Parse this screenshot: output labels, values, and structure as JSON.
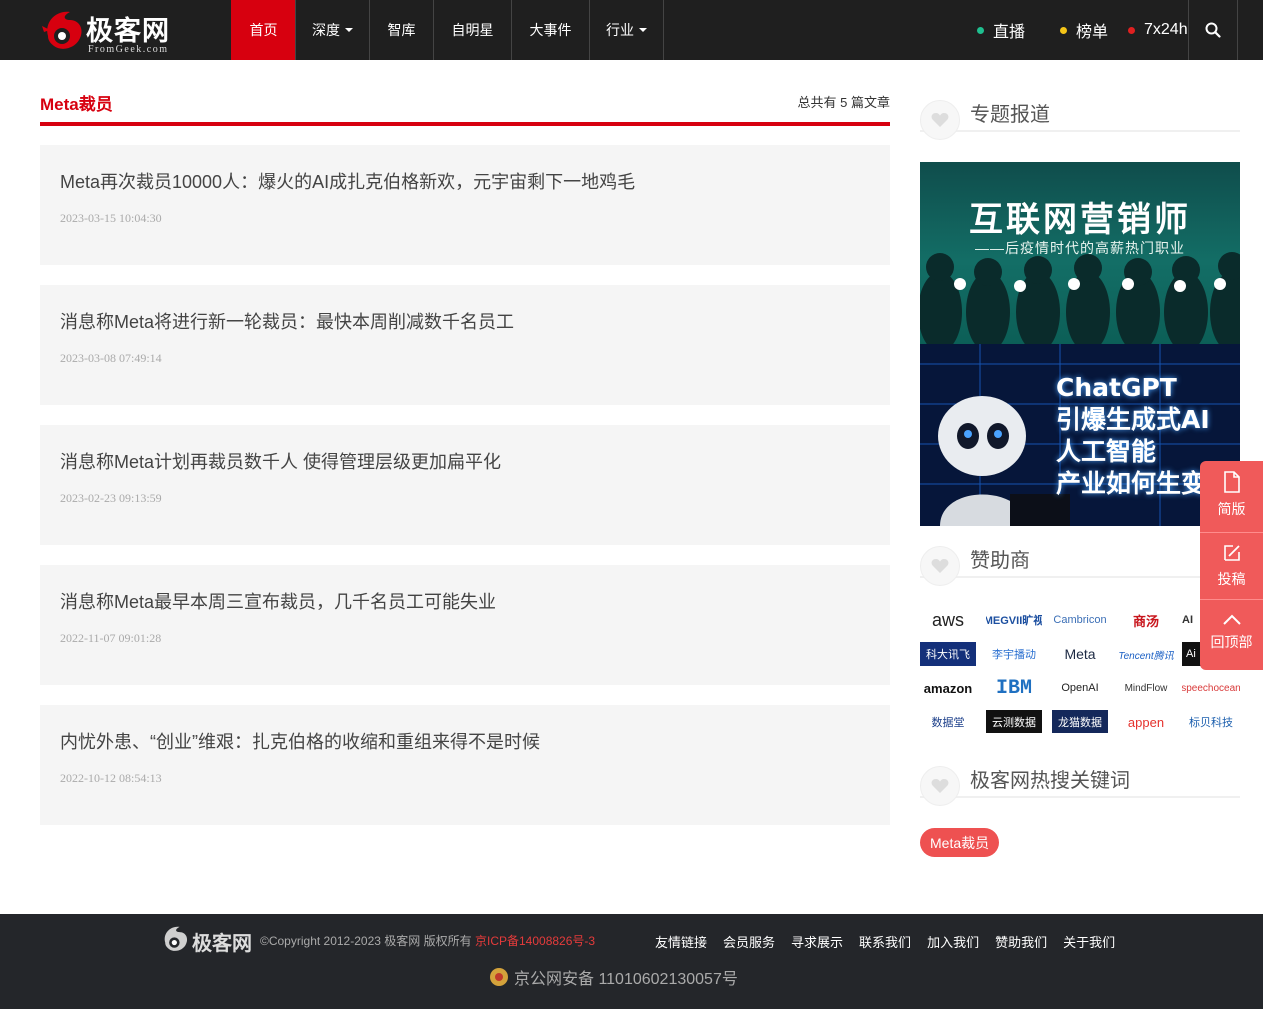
{
  "colors": {
    "brand_red": "#d7000f",
    "nav_bg": "#1f1f1f",
    "card_bg": "#f5f5f5",
    "float_red": "#f05a5a",
    "tag_red": "#ee5151",
    "footer_bg": "#24262a"
  },
  "logo": {
    "cn": "极客网",
    "en": "FromGeek.com"
  },
  "nav": {
    "items": [
      {
        "label": "首页",
        "dropdown": false,
        "active": true
      },
      {
        "label": "深度",
        "dropdown": true,
        "active": false
      },
      {
        "label": "智库",
        "dropdown": false,
        "active": false
      },
      {
        "label": "自明星",
        "dropdown": false,
        "active": false
      },
      {
        "label": "大事件",
        "dropdown": false,
        "active": false
      },
      {
        "label": "行业",
        "dropdown": true,
        "active": false
      }
    ],
    "quick": [
      {
        "label": "直播",
        "dot_color": "#1fbf8f"
      },
      {
        "label": "榜单",
        "dot_color": "#f5c518"
      },
      {
        "label": "7x24h",
        "dot_color": "#e02020"
      }
    ],
    "search_icon": "search-icon"
  },
  "list": {
    "title": "Meta裁员",
    "count_text": "总共有 5 篇文章",
    "articles": [
      {
        "title": "Meta再次裁员10000人：爆火的AI成扎克伯格新欢，元宇宙剩下一地鸡毛",
        "date": "2023-03-15 10:04:30"
      },
      {
        "title": "消息称Meta将进行新一轮裁员：最快本周削减数千名员工",
        "date": "2023-03-08 07:49:14"
      },
      {
        "title": "消息称Meta计划再裁员数千人 使得管理层级更加扁平化",
        "date": "2023-02-23 09:13:59"
      },
      {
        "title": "消息称Meta最早本周三宣布裁员，几千名员工可能失业",
        "date": "2022-11-07 09:01:28"
      },
      {
        "title": "内忧外患、“创业”维艰：扎克伯格的收缩和重组来得不是时候",
        "date": "2022-10-12 08:54:13"
      }
    ]
  },
  "sidebar": {
    "special_title": "专题报道",
    "banner1": {
      "title": "互联网营销师",
      "subtitle": "——后疫情时代的高薪热门职业"
    },
    "banner2": {
      "lines": [
        "ChatGPT",
        "引爆生成式AI",
        "人工智能",
        "产业如何生变"
      ]
    },
    "sponsors_title": "赞助商",
    "sponsors": [
      {
        "name": "aws",
        "color": "#222222"
      },
      {
        "name": "MEGVII旷视",
        "color": "#1c4fa0"
      },
      {
        "name": "Cambricon",
        "color": "#3b6fb6"
      },
      {
        "name": "商汤",
        "color": "#c8161d"
      },
      {
        "name": "AI",
        "color": "#333333"
      },
      {
        "name": "科大讯飞",
        "color": "#ffffff"
      },
      {
        "name": "李宇播动",
        "color": "#2a6fd0"
      },
      {
        "name": "Meta",
        "color": "#1d2a44"
      },
      {
        "name": "Tencent腾讯",
        "color": "#1a5fc4"
      },
      {
        "name": "Ai",
        "color": "#ffffff"
      },
      {
        "name": "amazon",
        "color": "#111111"
      },
      {
        "name": "IBM",
        "color": "#1f70c1"
      },
      {
        "name": "OpenAI",
        "color": "#222222"
      },
      {
        "name": "MindFlow",
        "color": "#333333"
      },
      {
        "name": "speechocean",
        "color": "#d93a3a"
      },
      {
        "name": "数据堂",
        "color": "#1c3f8a"
      },
      {
        "name": "云测数据",
        "color": "#ffffff"
      },
      {
        "name": "龙猫数据",
        "color": "#ffffff"
      },
      {
        "name": "appen",
        "color": "#e5322d"
      },
      {
        "name": "标贝科技",
        "color": "#1c5fae"
      }
    ],
    "hot_title": "极客网热搜关键词",
    "hot_tags": [
      "Meta裁员"
    ]
  },
  "float_tools": [
    {
      "label": "简版",
      "icon": "document-icon"
    },
    {
      "label": "投稿",
      "icon": "edit-icon"
    },
    {
      "label": "回顶部",
      "icon": "chevron-up-icon"
    }
  ],
  "footer": {
    "copyright": "©Copyright 2012-2023 极客网 版权所有",
    "icp": "京ICP备14008826号-3",
    "links": [
      "友情链接",
      "会员服务",
      "寻求展示",
      "联系我们",
      "加入我们",
      "赞助我们",
      "关于我们"
    ],
    "police": "京公网安备 11010602130057号"
  }
}
